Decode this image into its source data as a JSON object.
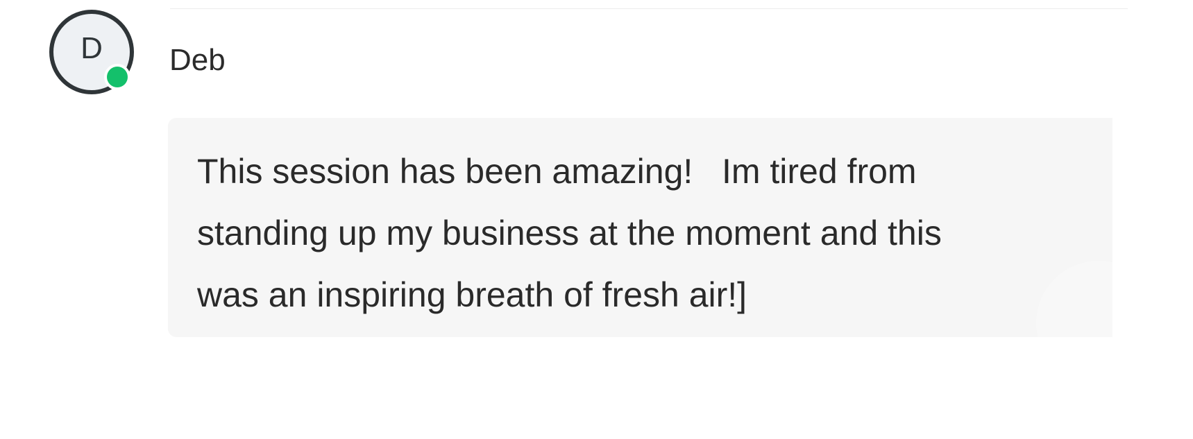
{
  "message": {
    "author_initial": "D",
    "author_name": "Deb",
    "presence_status": "online",
    "presence_color": "#14c06b",
    "body": "This session has been amazing!   Im tired from\nstanding up my business at the moment and this\nwas an inspiring breath of fresh air!]"
  }
}
